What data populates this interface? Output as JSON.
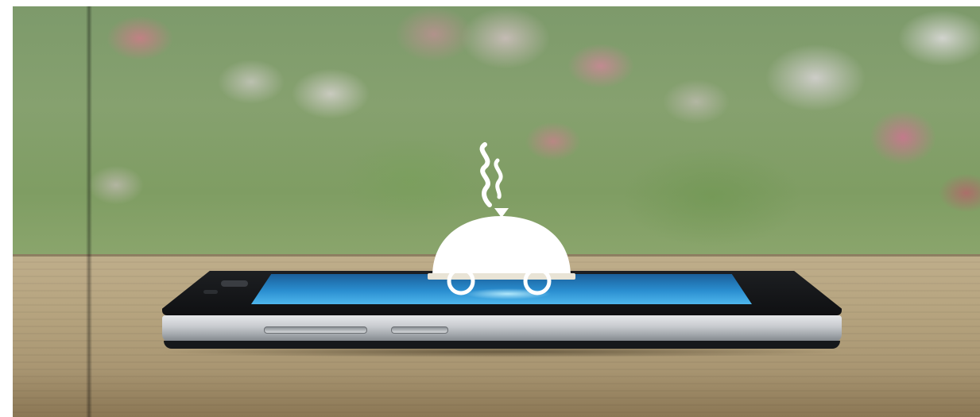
{
  "image": {
    "subject": "food-delivery-concept",
    "icon": "cloche-delivery-cart-icon",
    "device": "smartphone"
  },
  "colors": {
    "screen": "#2a8ed0",
    "icon": "#ffffff",
    "wood": "#b6a47f",
    "garden": "#86a16f"
  }
}
